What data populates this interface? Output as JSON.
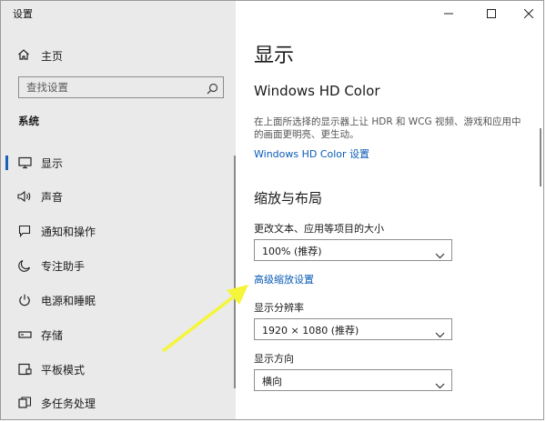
{
  "app": {
    "title": "设置"
  },
  "window": {
    "minimize_icon": "minimize-icon",
    "maximize_icon": "maximize-icon",
    "close_icon": "close-icon"
  },
  "sidebar": {
    "home_label": "主页",
    "search_placeholder": "查找设置",
    "section_title": "系统",
    "items": [
      {
        "label": "显示",
        "icon": "monitor-icon",
        "selected": true
      },
      {
        "label": "声音",
        "icon": "speaker-icon"
      },
      {
        "label": "通知和操作",
        "icon": "notification-icon"
      },
      {
        "label": "专注助手",
        "icon": "moon-icon"
      },
      {
        "label": "电源和睡眠",
        "icon": "power-icon"
      },
      {
        "label": "存储",
        "icon": "storage-icon"
      },
      {
        "label": "平板模式",
        "icon": "tablet-icon"
      },
      {
        "label": "多任务处理",
        "icon": "multitask-icon"
      }
    ]
  },
  "main": {
    "page_title": "显示",
    "hd_color": {
      "title": "Windows HD Color",
      "description": "在上面所选择的显示器上让 HDR 和 WCG 视频、游戏和应用中的画面更明亮、更生动。",
      "link": "Windows HD Color 设置"
    },
    "scale_layout": {
      "title": "缩放与布局",
      "scale_label": "更改文本、应用等项目的大小",
      "scale_value": "100% (推荐)",
      "advanced_link": "高级缩放设置",
      "resolution_label": "显示分辨率",
      "resolution_value": "1920 × 1080 (推荐)",
      "orientation_label": "显示方向",
      "orientation_value": "横向"
    }
  },
  "colors": {
    "accent": "#0a5bb5",
    "sidebar_bg": "#eaeaea",
    "annotation_arrow": "#f5f53a"
  }
}
